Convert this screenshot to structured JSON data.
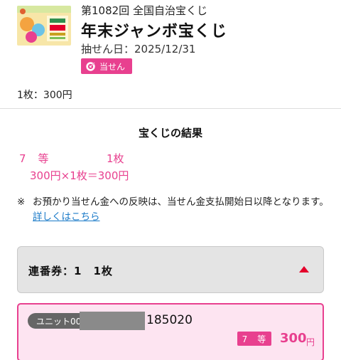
{
  "lottery": {
    "round": "第1082回 全国自治宝くじ",
    "title": "年末ジャンボ宝くじ",
    "draw_date": "抽せん日：2025/12/31",
    "badge": "当せん",
    "badge_icon": "target-icon",
    "price": "1枚：300円"
  },
  "result": {
    "heading": "宝くじの結果",
    "rank": "7　等",
    "count": "1枚",
    "calc": "300円×1枚＝300円",
    "note_mark": "※",
    "note_text": "お預かり当せん金への反映は、当せん金支払開始日以降となります。",
    "note_link": "詳しくはこちら"
  },
  "serial": {
    "label": "連番券：1　1枚",
    "toggle_icon": "triangle-up-icon"
  },
  "ticket": {
    "unit_prefix": "ユニット00",
    "number": "185020",
    "rank": "7　等",
    "amount": "300",
    "currency": "円"
  },
  "colors": {
    "accent": "#e8408f",
    "link": "#1a7ac8",
    "caret": "#e4002b"
  }
}
